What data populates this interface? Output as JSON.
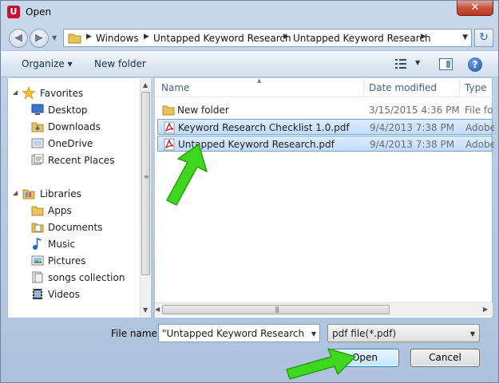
{
  "window": {
    "title": "Open",
    "app_icon_text": "U",
    "close_glyph": "✕"
  },
  "address": {
    "crumbs": [
      "Windows",
      "Untapped Keyword Research",
      "Untapped Keyword Research"
    ]
  },
  "toolbar": {
    "organize_label": "Organize ▾",
    "new_folder_label": "New folder",
    "help_glyph": "?"
  },
  "nav": {
    "favorites_label": "Favorites",
    "favorites": [
      {
        "label": "Desktop",
        "icon": "desktop-icon"
      },
      {
        "label": "Downloads",
        "icon": "downloads-folder-icon"
      },
      {
        "label": "OneDrive",
        "icon": "onedrive-icon"
      },
      {
        "label": "Recent Places",
        "icon": "recent-places-icon"
      }
    ],
    "libraries_label": "Libraries",
    "libraries": [
      {
        "label": "Apps",
        "icon": "folder-icon"
      },
      {
        "label": "Documents",
        "icon": "documents-icon"
      },
      {
        "label": "Music",
        "icon": "music-icon"
      },
      {
        "label": "Pictures",
        "icon": "pictures-icon"
      },
      {
        "label": "songs collection",
        "icon": "library-icon"
      },
      {
        "label": "Videos",
        "icon": "videos-icon"
      }
    ]
  },
  "files": {
    "columns": {
      "name": "Name",
      "date": "Date modified",
      "type": "Type"
    },
    "rows": [
      {
        "name": "New folder",
        "date": "3/15/2015 4:36 PM",
        "type": "File fol",
        "icon": "folder-icon",
        "selected": false
      },
      {
        "name": "Keyword Research Checklist 1.0.pdf",
        "date": "9/4/2013 7:38 PM",
        "type": "Adobe",
        "icon": "pdf-icon",
        "selected": true
      },
      {
        "name": "Untapped Keyword Research.pdf",
        "date": "9/4/2013 7:38 PM",
        "type": "Adobe",
        "icon": "pdf-icon",
        "selected": true
      }
    ]
  },
  "bottom": {
    "file_name_label": "File name:",
    "file_name_value": "\"Untapped Keyword Research.pdf\"",
    "filter_value": "pdf file(*.pdf)",
    "open_label": "Open",
    "cancel_label": "Cancel"
  },
  "colors": {
    "arrow_green": "#3fd81f",
    "selection": "#c2dcfd",
    "close_red": "#c7503c"
  }
}
